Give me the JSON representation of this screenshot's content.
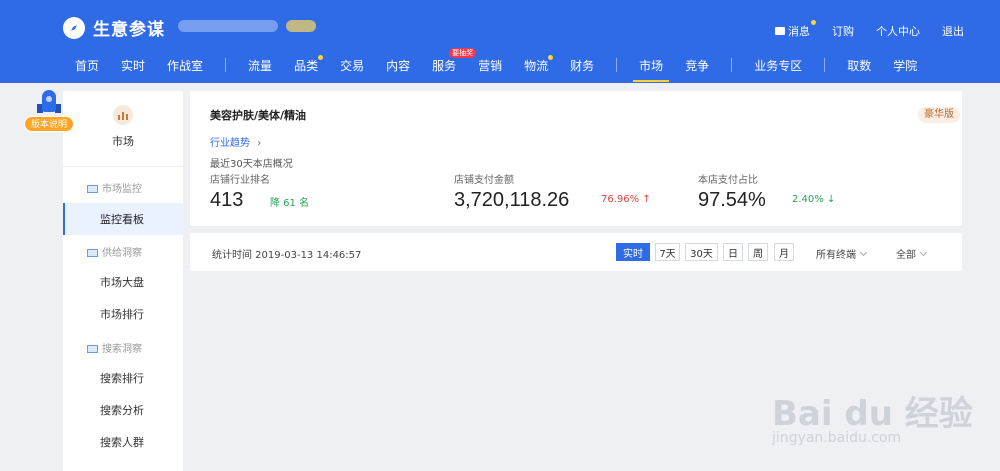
{
  "header": {
    "brand_title": "生意参谋",
    "top_links": {
      "messages": "消息",
      "orders": "订购",
      "profile": "个人中心",
      "logout": "退出"
    },
    "nav": [
      {
        "label": "首页"
      },
      {
        "label": "实时"
      },
      {
        "label": "作战室"
      },
      {
        "label": "流量"
      },
      {
        "label": "品类"
      },
      {
        "label": "交易"
      },
      {
        "label": "内容"
      },
      {
        "label": "服务",
        "badge": "要抽奖"
      },
      {
        "label": "营销"
      },
      {
        "label": "物流"
      },
      {
        "label": "财务"
      },
      {
        "label": "市场",
        "active": true
      },
      {
        "label": "竞争"
      },
      {
        "label": "业务专区"
      },
      {
        "label": "取数"
      },
      {
        "label": "学院"
      }
    ]
  },
  "rocket": {
    "label": "版本说明"
  },
  "sidebar": {
    "top_label": "市场",
    "groups": [
      {
        "label": "市场监控",
        "items": [
          "监控看板"
        ]
      },
      {
        "label": "供给洞察",
        "items": [
          "市场大盘",
          "市场排行"
        ]
      },
      {
        "label": "搜索洞察",
        "items": [
          "搜索排行",
          "搜索分析",
          "搜索人群"
        ]
      }
    ],
    "active_item": "监控看板"
  },
  "card": {
    "title": "美容护肤/美体/精油",
    "badge": "豪华版",
    "trend_link": "行业趋势",
    "overview": "最近30天本店概况",
    "metrics": [
      {
        "label": "店铺行业排名",
        "value": "413",
        "change": "降 61 名",
        "direction": "down"
      },
      {
        "label": "店铺支付金额",
        "value": "3,720,118.26",
        "change": "76.96%",
        "direction": "up"
      },
      {
        "label": "本店支付占比",
        "value": "97.54%",
        "change": "2.40%",
        "direction": "down"
      }
    ]
  },
  "timebar": {
    "stat_time": "统计时间 2019-03-13 14:46:57",
    "ranges": [
      "实时",
      "7天",
      "30天",
      "日",
      "周",
      "月"
    ],
    "active_range": "实时",
    "device_filter": "所有终端",
    "scope_filter": "全部"
  },
  "watermark": {
    "text": "Bai du 经验",
    "sub": "jingyan.baidu.com"
  },
  "colors": {
    "header": "#2f6be6",
    "accent": "#ffcf3c",
    "up": "#e0443c",
    "down": "#2aa256"
  }
}
